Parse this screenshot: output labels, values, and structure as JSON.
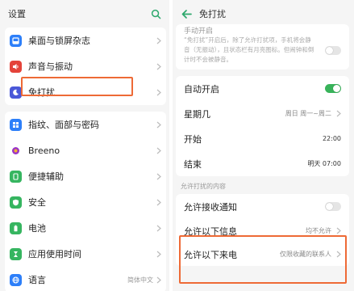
{
  "left": {
    "title": "设置",
    "items": [
      {
        "label": "桌面与锁屏杂志",
        "icon": "wallpaper-icon",
        "color": "#2d7ff9",
        "value": ""
      },
      {
        "label": "声音与振动",
        "icon": "speaker-icon",
        "color": "#e4433a",
        "value": ""
      },
      {
        "label": "免打扰",
        "icon": "moon-icon",
        "color": "#4a58d8",
        "value": ""
      },
      {
        "label": "指纹、面部与密码",
        "icon": "fingerprint-icon",
        "color": "#2d7ff9",
        "value": ""
      },
      {
        "label": "Breeno",
        "icon": "breeno-icon",
        "color": "#9a34c7",
        "value": ""
      },
      {
        "label": "便捷辅助",
        "icon": "assist-icon",
        "color": "#36b560",
        "value": ""
      },
      {
        "label": "安全",
        "icon": "shield-icon",
        "color": "#36b560",
        "value": ""
      },
      {
        "label": "电池",
        "icon": "battery-icon",
        "color": "#36b560",
        "value": ""
      },
      {
        "label": "应用使用时间",
        "icon": "hourglass-icon",
        "color": "#36b560",
        "value": ""
      },
      {
        "label": "语言",
        "icon": "globe-icon",
        "color": "#2d7ff9",
        "value": "简体中文"
      }
    ]
  },
  "right": {
    "title": "免打扰",
    "manual_label": "手动开启",
    "note": "“免打扰”开启后，除了允许打扰项，手机将会静音（无振动），且状态栏有月亮图标。但闹钟和倒计时不会被静音。",
    "auto_label": "自动开启",
    "weekday_label": "星期几",
    "weekday_value": "周日 周一~周二",
    "start_label": "开始",
    "start_value": "22:00",
    "end_label": "结束",
    "end_value": "明天 07:00",
    "section_label": "允许打扰的内容",
    "allow_notif_label": "允许接收通知",
    "allow_msg_label": "允许以下信息",
    "allow_msg_value": "均不允许",
    "allow_call_label": "允许以下来电",
    "allow_call_value": "仅限收藏的联系人"
  },
  "colors": {
    "highlight": "#ee6a36",
    "toggle_on": "#38b35a",
    "accent": "#2da86c"
  }
}
